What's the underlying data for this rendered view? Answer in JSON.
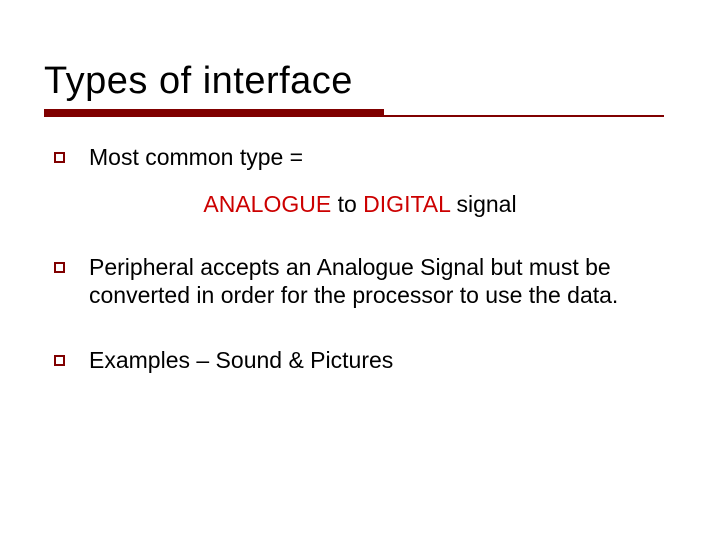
{
  "slide": {
    "title": "Types of interface",
    "bullets": {
      "b1": "Most common type =",
      "center_pre": "ANALOGUE ",
      "center_mid": "to",
      "center_post1": " DIGITAL ",
      "center_post2": "signal",
      "b2": " Peripheral accepts an Analogue Signal but must be converted in order for the processor to use the data.",
      "b3": "Examples – Sound & Pictures"
    }
  }
}
